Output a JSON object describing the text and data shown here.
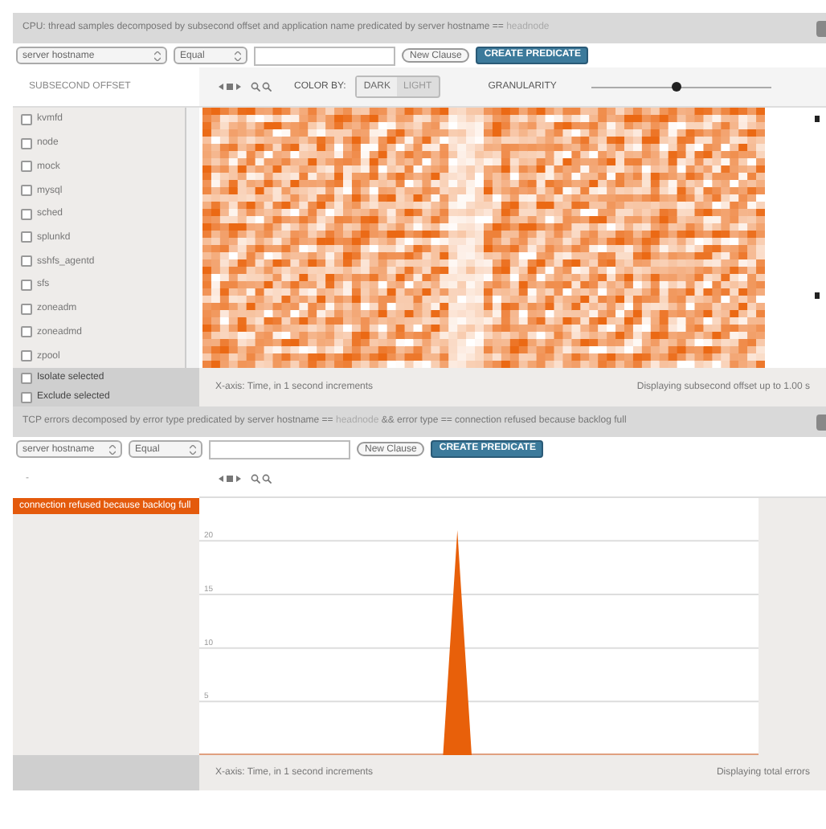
{
  "panels": [
    {
      "kind": "heatmap",
      "title": "CPU: thread samples decomposed by subsecond offset and application name predicated by server hostname ==",
      "title_link": "headnode",
      "predicate": {
        "field": "server hostname",
        "operator": "Equal",
        "buttons": [
          "New Clause",
          "CREATE PREDICATE"
        ]
      },
      "sidebar_header": "SUBSECOND OFFSET",
      "color_by_label": "COLOR BY:",
      "color_options": [
        {
          "label": "DARK",
          "selected": true
        },
        {
          "label": "LIGHT",
          "selected": false
        }
      ],
      "granularity_label": "GRANULARITY",
      "granularity": {
        "level": 0.47
      },
      "items": [
        {
          "label": "kvmfd",
          "checked": false
        },
        {
          "label": "node",
          "checked": false
        },
        {
          "label": "mock",
          "checked": false
        },
        {
          "label": "mysql",
          "checked": false
        },
        {
          "label": "sched",
          "checked": false
        },
        {
          "label": "splunkd",
          "checked": false
        },
        {
          "label": "sshfs_agentd",
          "checked": false
        },
        {
          "label": "sfs",
          "checked": false
        },
        {
          "label": "zoneadm",
          "checked": false
        },
        {
          "label": "zoneadmd",
          "checked": false
        },
        {
          "label": "zpool",
          "checked": false
        }
      ],
      "filters": [
        {
          "label": "Isolate selected",
          "checked": false
        },
        {
          "label": "Exclude selected",
          "checked": false
        }
      ],
      "footer_left": "X-axis: Time, in 1 second increments",
      "footer_right": "Displaying subsecond offset up to 1.00 s"
    },
    {
      "kind": "area",
      "title": "TCP errors decomposed by error type predicated by server hostname ==",
      "title_link": "headnode",
      "title_after": "&& error type == connection refused because backlog full",
      "predicate": {
        "field": "server hostname",
        "operator": "Equal",
        "buttons": [
          "New Clause",
          "CREATE PREDICATE"
        ]
      },
      "sidebar_header": "-",
      "items": [
        {
          "label": "connection refused because backlog full",
          "selected": true
        }
      ],
      "chart_data": {
        "type": "area",
        "grid": true,
        "ylim": [
          0,
          24
        ],
        "yticks": [
          5,
          10,
          15,
          20
        ],
        "values": [
          0,
          0,
          0,
          0,
          0,
          0,
          0,
          0,
          0,
          0,
          0,
          0,
          0,
          0,
          0,
          0,
          0,
          0,
          21,
          0,
          0,
          0,
          0,
          0,
          0,
          0,
          0,
          0,
          0,
          0,
          0,
          0,
          0,
          0,
          0,
          0,
          0,
          0,
          0,
          0
        ]
      },
      "footer_left": "X-axis: Time, in 1 second increments",
      "footer_right": "Displaying total errors"
    }
  ]
}
